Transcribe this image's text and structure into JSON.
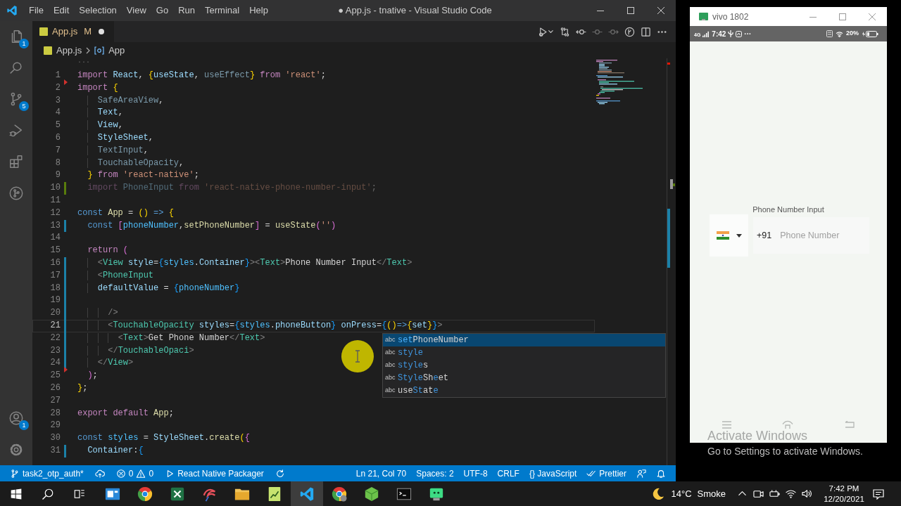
{
  "editor_window": {
    "title": "● App.js - tnative - Visual Studio Code",
    "menu": [
      "File",
      "Edit",
      "Selection",
      "View",
      "Go",
      "Run",
      "Terminal",
      "Help"
    ],
    "activity_bar": {
      "top": [
        {
          "kind": "files",
          "badge": "1"
        },
        {
          "kind": "search"
        },
        {
          "kind": "source_control",
          "badge": "5"
        },
        {
          "kind": "run_debug"
        },
        {
          "kind": "extensions"
        },
        {
          "kind": "git_graph"
        }
      ],
      "bottom": [
        {
          "kind": "accounts",
          "badge": "1"
        },
        {
          "kind": "settings"
        }
      ]
    },
    "tabs": [
      {
        "label": "App.js",
        "git_status": "M",
        "dirty": true,
        "selected": true
      }
    ],
    "breadcrumb": [
      {
        "kind": "file",
        "label": "App.js"
      },
      {
        "kind": "symbol",
        "label": "App"
      }
    ],
    "fold_hint": "···",
    "lines": [
      {
        "number": "1",
        "kind": "plain",
        "current": false,
        "faded": false,
        "tokens": [
          {
            "text": "import",
            "kind": "keyword"
          },
          {
            "text": " React",
            "kind": "var"
          },
          {
            "text": ", ",
            "kind": "punct"
          },
          {
            "text": "{",
            "kind": "brace1"
          },
          {
            "text": "useState",
            "kind": "var"
          },
          {
            "text": ", ",
            "kind": "punct"
          },
          {
            "text": "useEffect",
            "kind": "unused"
          },
          {
            "text": "}",
            "kind": "brace1"
          },
          {
            "text": " from",
            "kind": "keyword"
          },
          {
            "text": " 'react'",
            "kind": "string"
          },
          {
            "text": ";",
            "kind": "punct"
          }
        ]
      },
      {
        "number": "2",
        "kind": "deleted",
        "current": false,
        "faded": false,
        "tokens": [
          {
            "text": "import",
            "kind": "keyword"
          },
          {
            "text": " {",
            "kind": "brace1"
          }
        ]
      },
      {
        "number": "3",
        "kind": "plain",
        "current": false,
        "faded": false,
        "tokens": [
          {
            "text": "    SafeAreaView",
            "kind": "unused"
          },
          {
            "text": ",",
            "kind": "punct"
          }
        ]
      },
      {
        "number": "4",
        "kind": "plain",
        "current": false,
        "faded": false,
        "tokens": [
          {
            "text": "    Text",
            "kind": "var"
          },
          {
            "text": ",",
            "kind": "punct"
          }
        ]
      },
      {
        "number": "5",
        "kind": "plain",
        "current": false,
        "faded": false,
        "tokens": [
          {
            "text": "    View",
            "kind": "var"
          },
          {
            "text": ",",
            "kind": "punct"
          }
        ]
      },
      {
        "number": "6",
        "kind": "plain",
        "current": false,
        "faded": false,
        "tokens": [
          {
            "text": "    StyleSheet",
            "kind": "var"
          },
          {
            "text": ",",
            "kind": "punct"
          }
        ]
      },
      {
        "number": "7",
        "kind": "plain",
        "current": false,
        "faded": false,
        "tokens": [
          {
            "text": "    TextInput",
            "kind": "unused"
          },
          {
            "text": ",",
            "kind": "punct"
          }
        ]
      },
      {
        "number": "8",
        "kind": "plain",
        "current": false,
        "faded": false,
        "tokens": [
          {
            "text": "    TouchableOpacity",
            "kind": "unused"
          },
          {
            "text": ",",
            "kind": "punct"
          }
        ]
      },
      {
        "number": "9",
        "kind": "plain",
        "current": false,
        "faded": false,
        "tokens": [
          {
            "text": "  }",
            "kind": "brace1"
          },
          {
            "text": " from",
            "kind": "keyword"
          },
          {
            "text": " 'react-native'",
            "kind": "string"
          },
          {
            "text": ";",
            "kind": "punct"
          }
        ]
      },
      {
        "number": "10",
        "kind": "added",
        "current": false,
        "faded": true,
        "tokens": [
          {
            "text": "  import",
            "kind": "keyword"
          },
          {
            "text": " PhoneInput",
            "kind": "var"
          },
          {
            "text": " from",
            "kind": "keyword"
          },
          {
            "text": " 'react-native-phone-number-input'",
            "kind": "string"
          },
          {
            "text": ";",
            "kind": "punct"
          }
        ]
      },
      {
        "number": "11",
        "kind": "plain",
        "current": false
      },
      {
        "number": "12",
        "kind": "plain",
        "current": false,
        "faded": false,
        "tokens": [
          {
            "text": "const",
            "kind": "storage"
          },
          {
            "text": " App",
            "kind": "func"
          },
          {
            "text": " = ",
            "kind": "punct"
          },
          {
            "text": "()",
            "kind": "brace1"
          },
          {
            "text": " =>",
            "kind": "storage"
          },
          {
            "text": " {",
            "kind": "brace1"
          }
        ]
      },
      {
        "number": "13",
        "kind": "modified",
        "current": false,
        "faded": false,
        "tokens": [
          {
            "text": "  const",
            "kind": "storage"
          },
          {
            "text": " [",
            "kind": "brace2"
          },
          {
            "text": "phoneNumber",
            "kind": "const"
          },
          {
            "text": ",",
            "kind": "punct"
          },
          {
            "text": "setPhoneNumber",
            "kind": "func"
          },
          {
            "text": "]",
            "kind": "brace2"
          },
          {
            "text": " = ",
            "kind": "punct"
          },
          {
            "text": "useState",
            "kind": "func"
          },
          {
            "text": "(",
            "kind": "brace2"
          },
          {
            "text": "''",
            "kind": "string"
          },
          {
            "text": ")",
            "kind": "brace2"
          }
        ]
      },
      {
        "number": "14",
        "kind": "plain",
        "current": false
      },
      {
        "number": "15",
        "kind": "plain",
        "current": false,
        "faded": false,
        "tokens": [
          {
            "text": "  return",
            "kind": "keyword"
          },
          {
            "text": " (",
            "kind": "brace2"
          }
        ]
      },
      {
        "number": "16",
        "kind": "modified",
        "current": false,
        "faded": false,
        "tokens": [
          {
            "text": "    <",
            "kind": "tag"
          },
          {
            "text": "View",
            "kind": "type"
          },
          {
            "text": " style",
            "kind": "var"
          },
          {
            "text": "=",
            "kind": "punct"
          },
          {
            "text": "{",
            "kind": "brace3"
          },
          {
            "text": "styles",
            "kind": "const"
          },
          {
            "text": ".",
            "kind": "punct"
          },
          {
            "text": "Container",
            "kind": "var"
          },
          {
            "text": "}",
            "kind": "brace3"
          },
          {
            "text": "><",
            "kind": "tag"
          },
          {
            "text": "Text",
            "kind": "type"
          },
          {
            "text": ">",
            "kind": "tag"
          },
          {
            "text": "Phone Number Input",
            "kind": "plain"
          },
          {
            "text": "</",
            "kind": "tag"
          },
          {
            "text": "Text",
            "kind": "type"
          },
          {
            "text": ">",
            "kind": "tag"
          }
        ]
      },
      {
        "number": "17",
        "kind": "modified",
        "current": false,
        "faded": false,
        "tokens": [
          {
            "text": "    <",
            "kind": "tag"
          },
          {
            "text": "PhoneInput",
            "kind": "type"
          }
        ]
      },
      {
        "number": "18",
        "kind": "modified",
        "current": false,
        "faded": false,
        "tokens": [
          {
            "text": "    defaultValue",
            "kind": "var"
          },
          {
            "text": " = ",
            "kind": "punct"
          },
          {
            "text": "{",
            "kind": "brace3"
          },
          {
            "text": "phoneNumber",
            "kind": "const"
          },
          {
            "text": "}",
            "kind": "brace3"
          }
        ]
      },
      {
        "number": "19",
        "kind": "modified",
        "current": false
      },
      {
        "number": "20",
        "kind": "modified",
        "current": false,
        "faded": false,
        "tokens": [
          {
            "text": "      />",
            "kind": "tag"
          }
        ]
      },
      {
        "number": "21",
        "kind": "modified",
        "current": true,
        "faded": false,
        "tokens": [
          {
            "text": "      <",
            "kind": "tag"
          },
          {
            "text": "TouchableOpacity",
            "kind": "type"
          },
          {
            "text": " styles",
            "kind": "var"
          },
          {
            "text": "=",
            "kind": "punct"
          },
          {
            "text": "{",
            "kind": "brace3"
          },
          {
            "text": "styles",
            "kind": "const"
          },
          {
            "text": ".",
            "kind": "punct"
          },
          {
            "text": "phoneButton",
            "kind": "var"
          },
          {
            "text": "}",
            "kind": "brace3"
          },
          {
            "text": " onPress",
            "kind": "var"
          },
          {
            "text": "=",
            "kind": "punct"
          },
          {
            "text": "{",
            "kind": "brace3"
          },
          {
            "text": "()",
            "kind": "brace1"
          },
          {
            "text": "=>",
            "kind": "storage"
          },
          {
            "text": "{",
            "kind": "brace1"
          },
          {
            "text": "set",
            "kind": "var"
          },
          {
            "text": "}",
            "kind": "brace1"
          },
          {
            "text": "}",
            "kind": "brace3"
          },
          {
            "text": ">",
            "kind": "tag"
          }
        ]
      },
      {
        "number": "22",
        "kind": "modified",
        "current": false,
        "faded": false,
        "tokens": [
          {
            "text": "        <",
            "kind": "tag"
          },
          {
            "text": "Text",
            "kind": "type"
          },
          {
            "text": ">",
            "kind": "tag"
          },
          {
            "text": "Get Phone Number",
            "kind": "plain"
          },
          {
            "text": "</",
            "kind": "tag"
          },
          {
            "text": "Text",
            "kind": "type"
          },
          {
            "text": ">",
            "kind": "tag"
          }
        ]
      },
      {
        "number": "23",
        "kind": "modified",
        "current": false,
        "faded": false,
        "tokens": [
          {
            "text": "      </",
            "kind": "tag"
          },
          {
            "text": "TouchableOpaci",
            "kind": "type"
          },
          {
            "text": ">",
            "kind": "tag"
          }
        ]
      },
      {
        "number": "24",
        "kind": "modified",
        "current": false,
        "faded": false,
        "tokens": [
          {
            "text": "    </",
            "kind": "tag"
          },
          {
            "text": "View",
            "kind": "type"
          },
          {
            "text": ">",
            "kind": "tag"
          }
        ]
      },
      {
        "number": "25",
        "kind": "deleted",
        "current": false,
        "faded": false,
        "tokens": [
          {
            "text": "  )",
            "kind": "brace2"
          },
          {
            "text": ";",
            "kind": "punct"
          }
        ]
      },
      {
        "number": "26",
        "kind": "plain",
        "current": false,
        "faded": false,
        "tokens": [
          {
            "text": "}",
            "kind": "brace1"
          },
          {
            "text": ";",
            "kind": "punct"
          }
        ]
      },
      {
        "number": "27",
        "kind": "plain",
        "current": false
      },
      {
        "number": "28",
        "kind": "plain",
        "current": false,
        "faded": false,
        "tokens": [
          {
            "text": "export",
            "kind": "keyword"
          },
          {
            "text": " default",
            "kind": "keyword"
          },
          {
            "text": " App",
            "kind": "func"
          },
          {
            "text": ";",
            "kind": "punct"
          }
        ]
      },
      {
        "number": "29",
        "kind": "plain",
        "current": false
      },
      {
        "number": "30",
        "kind": "plain",
        "current": false,
        "faded": false,
        "tokens": [
          {
            "text": "const",
            "kind": "storage"
          },
          {
            "text": " styles",
            "kind": "const"
          },
          {
            "text": " = ",
            "kind": "punct"
          },
          {
            "text": "StyleSheet",
            "kind": "var"
          },
          {
            "text": ".",
            "kind": "punct"
          },
          {
            "text": "create",
            "kind": "func"
          },
          {
            "text": "(",
            "kind": "brace1"
          },
          {
            "text": "{",
            "kind": "brace2"
          }
        ]
      },
      {
        "number": "31",
        "kind": "modified",
        "current": false,
        "faded": false,
        "tokens": [
          {
            "text": "  Container",
            "kind": "var"
          },
          {
            "text": ":",
            "kind": "punct"
          },
          {
            "text": "{",
            "kind": "brace3"
          }
        ]
      }
    ],
    "suggestions": [
      {
        "type": "abc",
        "label": [
          {
            "text": "set",
            "match": true
          },
          {
            "text": "PhoneNumber",
            "match": false
          }
        ],
        "selected": true
      },
      {
        "type": "abc",
        "label": [
          {
            "text": "style",
            "match": true
          }
        ],
        "selected": false
      },
      {
        "type": "abc",
        "label": [
          {
            "text": "style",
            "match": true
          },
          {
            "text": "s",
            "match": false
          }
        ],
        "selected": false
      },
      {
        "type": "abc",
        "label": [
          {
            "text": "Style",
            "match": true
          },
          {
            "text": "Sh",
            "match": false
          },
          {
            "text": "e",
            "match": true
          },
          {
            "text": "et",
            "match": false
          }
        ],
        "selected": false
      },
      {
        "type": "abc",
        "label": [
          {
            "text": "use",
            "match": false
          },
          {
            "text": "St",
            "match": true
          },
          {
            "text": "at",
            "match": false
          },
          {
            "text": "e",
            "match": true
          }
        ],
        "selected": false
      }
    ],
    "status_bar": {
      "left": [
        {
          "kind": "branch",
          "text": "task2_otp_auth*"
        },
        {
          "kind": "sync"
        },
        {
          "kind": "problems",
          "errors": "0",
          "warnings": "0"
        },
        {
          "kind": "run",
          "text": "React Native Packager"
        },
        {
          "kind": "refresh"
        }
      ],
      "right": [
        {
          "kind": "text",
          "text": "Ln 21, Col 70"
        },
        {
          "kind": "text",
          "text": "Spaces: 2"
        },
        {
          "kind": "text",
          "text": "UTF-8"
        },
        {
          "kind": "text",
          "text": "CRLF"
        },
        {
          "kind": "text",
          "text": "{} JavaScript"
        },
        {
          "kind": "prettier",
          "text": "Prettier"
        },
        {
          "kind": "feedback"
        },
        {
          "kind": "bell"
        }
      ]
    }
  },
  "emulator": {
    "title": "vivo 1802",
    "status_bar": {
      "network": "4G",
      "time": "7:42",
      "more": "···",
      "battery": "20%"
    },
    "screen": {
      "heading": "Phone Number Input",
      "country_code": "+91",
      "placeholder": "Phone Number"
    }
  },
  "activation_notice": {
    "title": "Activate Windows",
    "subtitle": "Go to Settings to activate Windows."
  },
  "taskbar": {
    "buttons": [
      {
        "kind": "start"
      },
      {
        "kind": "search"
      },
      {
        "kind": "task_view"
      }
    ],
    "apps": [
      {
        "kind": "window",
        "selected": false
      },
      {
        "kind": "circle_logo",
        "selected": false
      },
      {
        "kind": "spreadsheet",
        "selected": false
      },
      {
        "kind": "scribble",
        "selected": false
      },
      {
        "kind": "folder",
        "selected": false
      },
      {
        "kind": "chart_note",
        "selected": false
      },
      {
        "kind": "code_editor",
        "selected": true
      },
      {
        "kind": "circle_logo_badge",
        "selected": false
      },
      {
        "kind": "cube",
        "selected": false
      },
      {
        "kind": "terminal",
        "selected": false
      },
      {
        "kind": "robot",
        "selected": false
      }
    ],
    "weather": {
      "temperature": "14°C",
      "condition": "Smoke"
    },
    "tray": [
      {
        "kind": "chevron"
      },
      {
        "kind": "camera"
      },
      {
        "kind": "power"
      },
      {
        "kind": "wifi"
      },
      {
        "kind": "speaker"
      }
    ],
    "clock": {
      "time": "7:42 PM",
      "date": "12/20/2021"
    }
  }
}
